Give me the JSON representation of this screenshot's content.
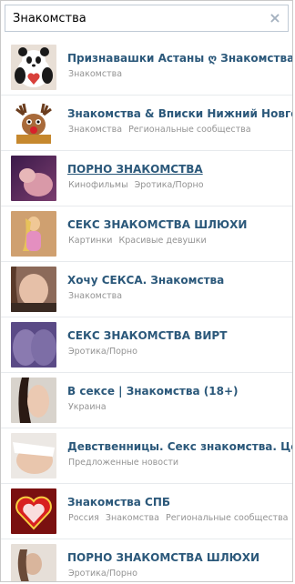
{
  "search": {
    "value": "Знакомства",
    "clear_icon": "close-icon"
  },
  "results": [
    {
      "title": "Признавашки Астаны ღ Знакомства",
      "categories": [
        "Знакомства"
      ],
      "thumb": "panda-heart-image"
    },
    {
      "title": "Знакомства & Вписки Нижний Новгород",
      "categories": [
        "Знакомства",
        "Региональные сообщества"
      ],
      "thumb": "reindeer-image"
    },
    {
      "title": "ПОРНО ЗНАКОМСТВА",
      "categories": [
        "Кинофильмы",
        "Эротика/Порно"
      ],
      "thumb": "photo-image"
    },
    {
      "title": "СЕКС ЗНАКОМСТВА ШЛЮХИ",
      "categories": [
        "Картинки",
        "Красивые девушки"
      ],
      "thumb": "photo-image"
    },
    {
      "title": "Хочу СЕКСА. Знакомства",
      "categories": [
        "Знакомства"
      ],
      "thumb": "photo-image"
    },
    {
      "title": "СЕКС ЗНАКОМСТВА ВИРТ",
      "categories": [
        "Эротика/Порно"
      ],
      "thumb": "photo-image"
    },
    {
      "title": "В сексе | Знакомства (18+)",
      "categories": [
        "Украина"
      ],
      "thumb": "photo-image"
    },
    {
      "title": "Девственницы. Секс знакомства. Целки",
      "categories": [
        "Предложенные новости"
      ],
      "thumb": "photo-image"
    },
    {
      "title": "Знакомства СПБ",
      "categories": [
        "Россия",
        "Знакомства",
        "Региональные сообщества"
      ],
      "thumb": "heart-image"
    },
    {
      "title": "ПОРНО ЗНАКОМСТВА ШЛЮХИ",
      "categories": [
        "Эротика/Порно"
      ],
      "thumb": "photo-image"
    }
  ],
  "colors": {
    "link": "#2b587a",
    "muted": "#939393",
    "border": "#c0cad5"
  }
}
